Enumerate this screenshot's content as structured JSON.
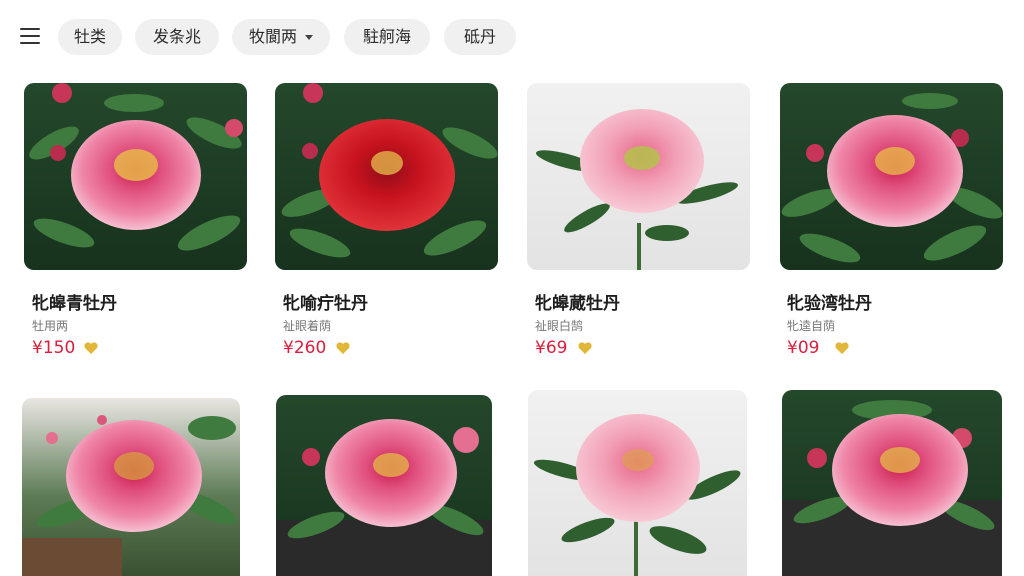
{
  "filters": [
    {
      "label": "牡类",
      "has_dropdown": false
    },
    {
      "label": "发条兆",
      "has_dropdown": false
    },
    {
      "label": "牧閬两",
      "has_dropdown": true
    },
    {
      "label": "駐舸海",
      "has_dropdown": false
    },
    {
      "label": "砥丹",
      "has_dropdown": false
    }
  ],
  "products": [
    {
      "name": "牝皞青牡丹",
      "sub": "牡用两",
      "price": "¥150",
      "bg": "dark"
    },
    {
      "name": "牝喻疔牡丹",
      "sub": "祉眼着荫",
      "price": "¥260",
      "bg": "dark"
    },
    {
      "name": "牝皞蕆牡丹",
      "sub": "祉眼白鹄",
      "price": "¥69",
      "bg": "light"
    },
    {
      "name": "牝验湾牡丹",
      "sub": "牝逵自荫",
      "price": "¥09",
      "bg": "dark"
    },
    {
      "bg": "mid"
    },
    {
      "bg": "dark"
    },
    {
      "bg": "light"
    },
    {
      "bg": "dark"
    }
  ],
  "colors": {
    "price": "#d8203e",
    "heart": "#e1b73a",
    "chip_bg": "#f0f0f0",
    "petal_pink": "#e86a93",
    "petal_red": "#d11a2a"
  }
}
